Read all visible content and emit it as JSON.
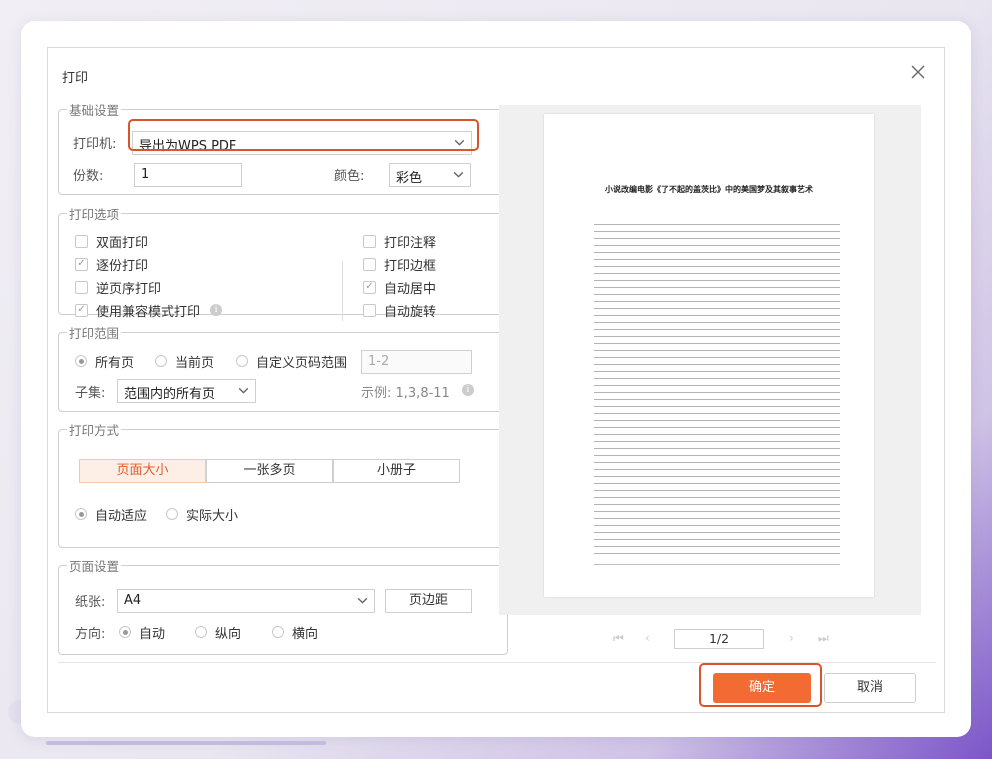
{
  "dialog": {
    "title": "打印"
  },
  "basic": {
    "legend": "基础设置",
    "printer_label": "打印机:",
    "printer_value": "导出为WPS PDF",
    "copies_label": "份数:",
    "copies_value": "1",
    "color_label": "颜色:",
    "color_value": "彩色"
  },
  "options": {
    "legend": "打印选项",
    "duplex": "双面打印",
    "collate": "逐份打印",
    "reverse": "逆页序打印",
    "compat": "使用兼容模式打印",
    "annotations": "打印注释",
    "borders": "打印边框",
    "autocenter": "自动居中",
    "autorotate": "自动旋转"
  },
  "range": {
    "legend": "打印范围",
    "all": "所有页",
    "current": "当前页",
    "custom": "自定义页码范围",
    "custom_placeholder": "1-2",
    "subset_label": "子集:",
    "subset_value": "范围内的所有页",
    "example": "示例: 1,3,8-11"
  },
  "mode": {
    "legend": "打印方式",
    "tab_pagesize": "页面大小",
    "tab_multi": "一张多页",
    "tab_booklet": "小册子",
    "fit": "自动适应",
    "actual": "实际大小"
  },
  "page": {
    "legend": "页面设置",
    "paper_label": "纸张:",
    "paper_value": "A4",
    "margins_btn": "页边距",
    "orient_label": "方向:",
    "auto": "自动",
    "portrait": "纵向",
    "landscape": "横向"
  },
  "preview": {
    "doc_title": "小说改编电影《了不起的盖茨比》中的美国梦及其叙事艺术",
    "page_indicator": "1/2"
  },
  "footer": {
    "ok": "确定",
    "cancel": "取消"
  },
  "colors": {
    "accent": "#f26b33",
    "highlight": "#d9532c"
  }
}
